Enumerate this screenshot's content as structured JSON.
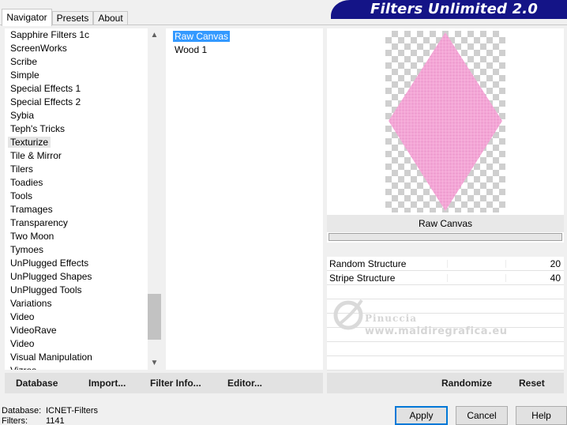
{
  "tabs": [
    "Navigator",
    "Presets",
    "About"
  ],
  "brand_title": "Filters Unlimited 2.0",
  "categories": [
    "Sapphire Filters 1c",
    "ScreenWorks",
    "Scribe",
    "Simple",
    "Special Effects 1",
    "Special Effects 2",
    "Sybia",
    "Teph's Tricks",
    "Texturize",
    "Tile & Mirror",
    "Tilers",
    "Toadies",
    "Tools",
    "Tramages",
    "Transparency",
    "Two Moon",
    "Tymoes",
    "UnPlugged Effects",
    "UnPlugged Shapes",
    "UnPlugged Tools",
    "Variations",
    "Video",
    "VideoRave",
    "Video",
    "Visual Manipulation",
    "Vizros"
  ],
  "selected_category": "Texturize",
  "filters": [
    "Raw Canvas",
    "Wood 1"
  ],
  "selected_filter": "Raw Canvas",
  "preview": {
    "filter_name": "Raw Canvas",
    "shape_color": "#f4a6d6"
  },
  "parameters": [
    {
      "label": "Random Structure",
      "value": "20"
    },
    {
      "label": "Stripe Structure",
      "value": "40"
    }
  ],
  "watermark": {
    "name": "Pinuccia",
    "url": "www.maldiregrafica.eu"
  },
  "left_buttons": {
    "database": "Database",
    "import": "Import...",
    "filter_info": "Filter Info...",
    "editor": "Editor..."
  },
  "right_buttons": {
    "randomize": "Randomize",
    "reset": "Reset"
  },
  "status": {
    "database_label": "Database:",
    "database_value": "ICNET-Filters",
    "filters_label": "Filters:",
    "filters_value": "1141"
  },
  "dialog_buttons": {
    "apply": "Apply",
    "cancel": "Cancel",
    "help": "Help"
  },
  "colors": {
    "brand_bg": "#141487",
    "selection": "#3399ff",
    "default_button_border": "#0078d7"
  }
}
